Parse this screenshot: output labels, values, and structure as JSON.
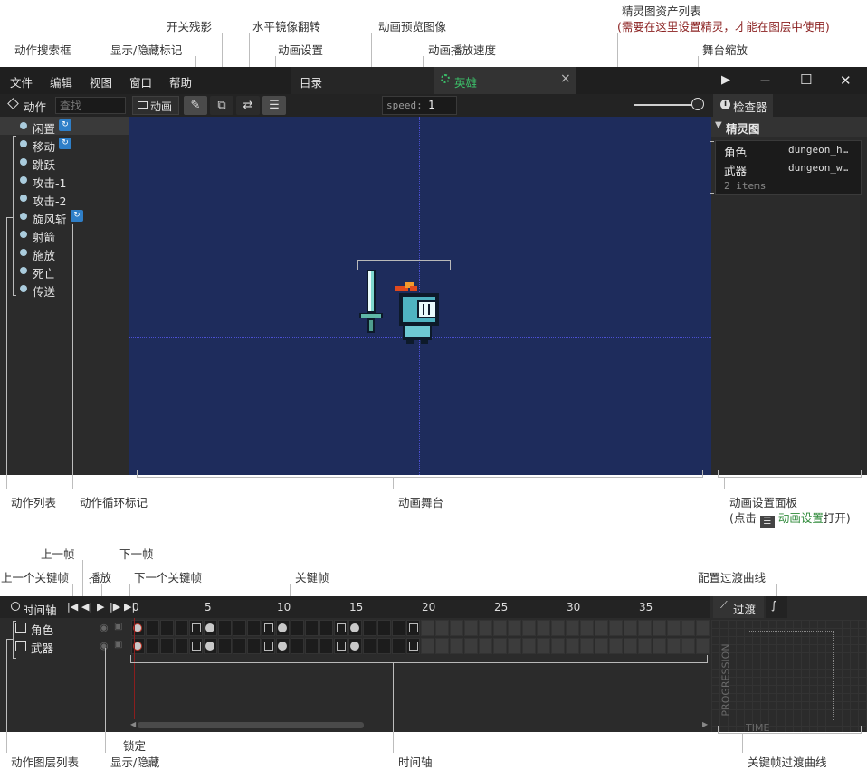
{
  "annotations": {
    "action_search": "动作搜索框",
    "show_hide_marks": "显示/隐藏标记",
    "toggle_onion": "开关残影",
    "mirror_flip": "水平镜像翻转",
    "anim_settings": "动画设置",
    "preview_image": "动画预览图像",
    "play_speed": "动画播放速度",
    "sprite_list_title": "精灵图资产列表",
    "sprite_list_note": "(需要在这里设置精灵，才能在图层中使用)",
    "stage_zoom": "舞台缩放",
    "action_list": "动作列表",
    "loop_mark": "动作循环标记",
    "anim_stage": "动画舞台",
    "settings_panel": "动画设置面板",
    "settings_hint_pre": "(点击",
    "settings_hint_link": "动画设置",
    "settings_hint_post": "打开)",
    "prev_frame": "上一帧",
    "next_frame": "下一帧",
    "prev_keyframe": "上一个关键帧",
    "play": "播放",
    "next_keyframe": "下一个关键帧",
    "keyframe": "关键帧",
    "config_curve": "配置过渡曲线",
    "layer_list": "动作图层列表",
    "lock": "锁定",
    "show_hide": "显示/隐藏",
    "timeline": "时间轴",
    "kf_curve": "关键帧过渡曲线"
  },
  "menu": [
    "文件",
    "编辑",
    "视图",
    "窗口",
    "帮助"
  ],
  "tabs": {
    "dir": "目录",
    "hero": "英雄",
    "close": "×"
  },
  "window_controls": {
    "play": "▶",
    "min": "—",
    "max": "☐",
    "close": "✕"
  },
  "toolbar": {
    "actions_label": "动作",
    "search_placeholder": "查找",
    "anim_label": "动画",
    "speed_label": "speed:",
    "speed_value": "1",
    "zoom_level": 1.0
  },
  "actions": [
    {
      "label": "闲置",
      "loop": true
    },
    {
      "label": "移动",
      "loop": true
    },
    {
      "label": "跳跃",
      "loop": false
    },
    {
      "label": "攻击-1",
      "loop": false
    },
    {
      "label": "攻击-2",
      "loop": false
    },
    {
      "label": "旋风斩",
      "loop": true
    },
    {
      "label": "射箭",
      "loop": false
    },
    {
      "label": "施放",
      "loop": false
    },
    {
      "label": "死亡",
      "loop": false
    },
    {
      "label": "传送",
      "loop": false
    }
  ],
  "inspector": {
    "tab": "检查器",
    "section": "精灵图",
    "rows": [
      {
        "name": "角色",
        "value": "dungeon_h…"
      },
      {
        "name": "武器",
        "value": "dungeon_w…"
      }
    ],
    "count": "2 items"
  },
  "timeline": {
    "title": "时间轴",
    "ticks": [
      "0",
      "5",
      "10",
      "15",
      "20",
      "25",
      "30",
      "35"
    ],
    "layers": [
      "角色",
      "武器"
    ],
    "total_frames": 40,
    "filled_frames": 19,
    "keyframes_round": [
      5,
      10,
      15
    ],
    "keyframes_square": [
      4,
      9,
      14,
      19
    ]
  },
  "transition": {
    "tab": "过渡",
    "y_label": "PROGRESSION",
    "x_label": "TIME"
  },
  "colors": {
    "stage_bg": "#1e2c5c",
    "accent_green": "#3cc06a",
    "loop_blue": "#2f7fc8",
    "playhead": "#c0392b"
  }
}
